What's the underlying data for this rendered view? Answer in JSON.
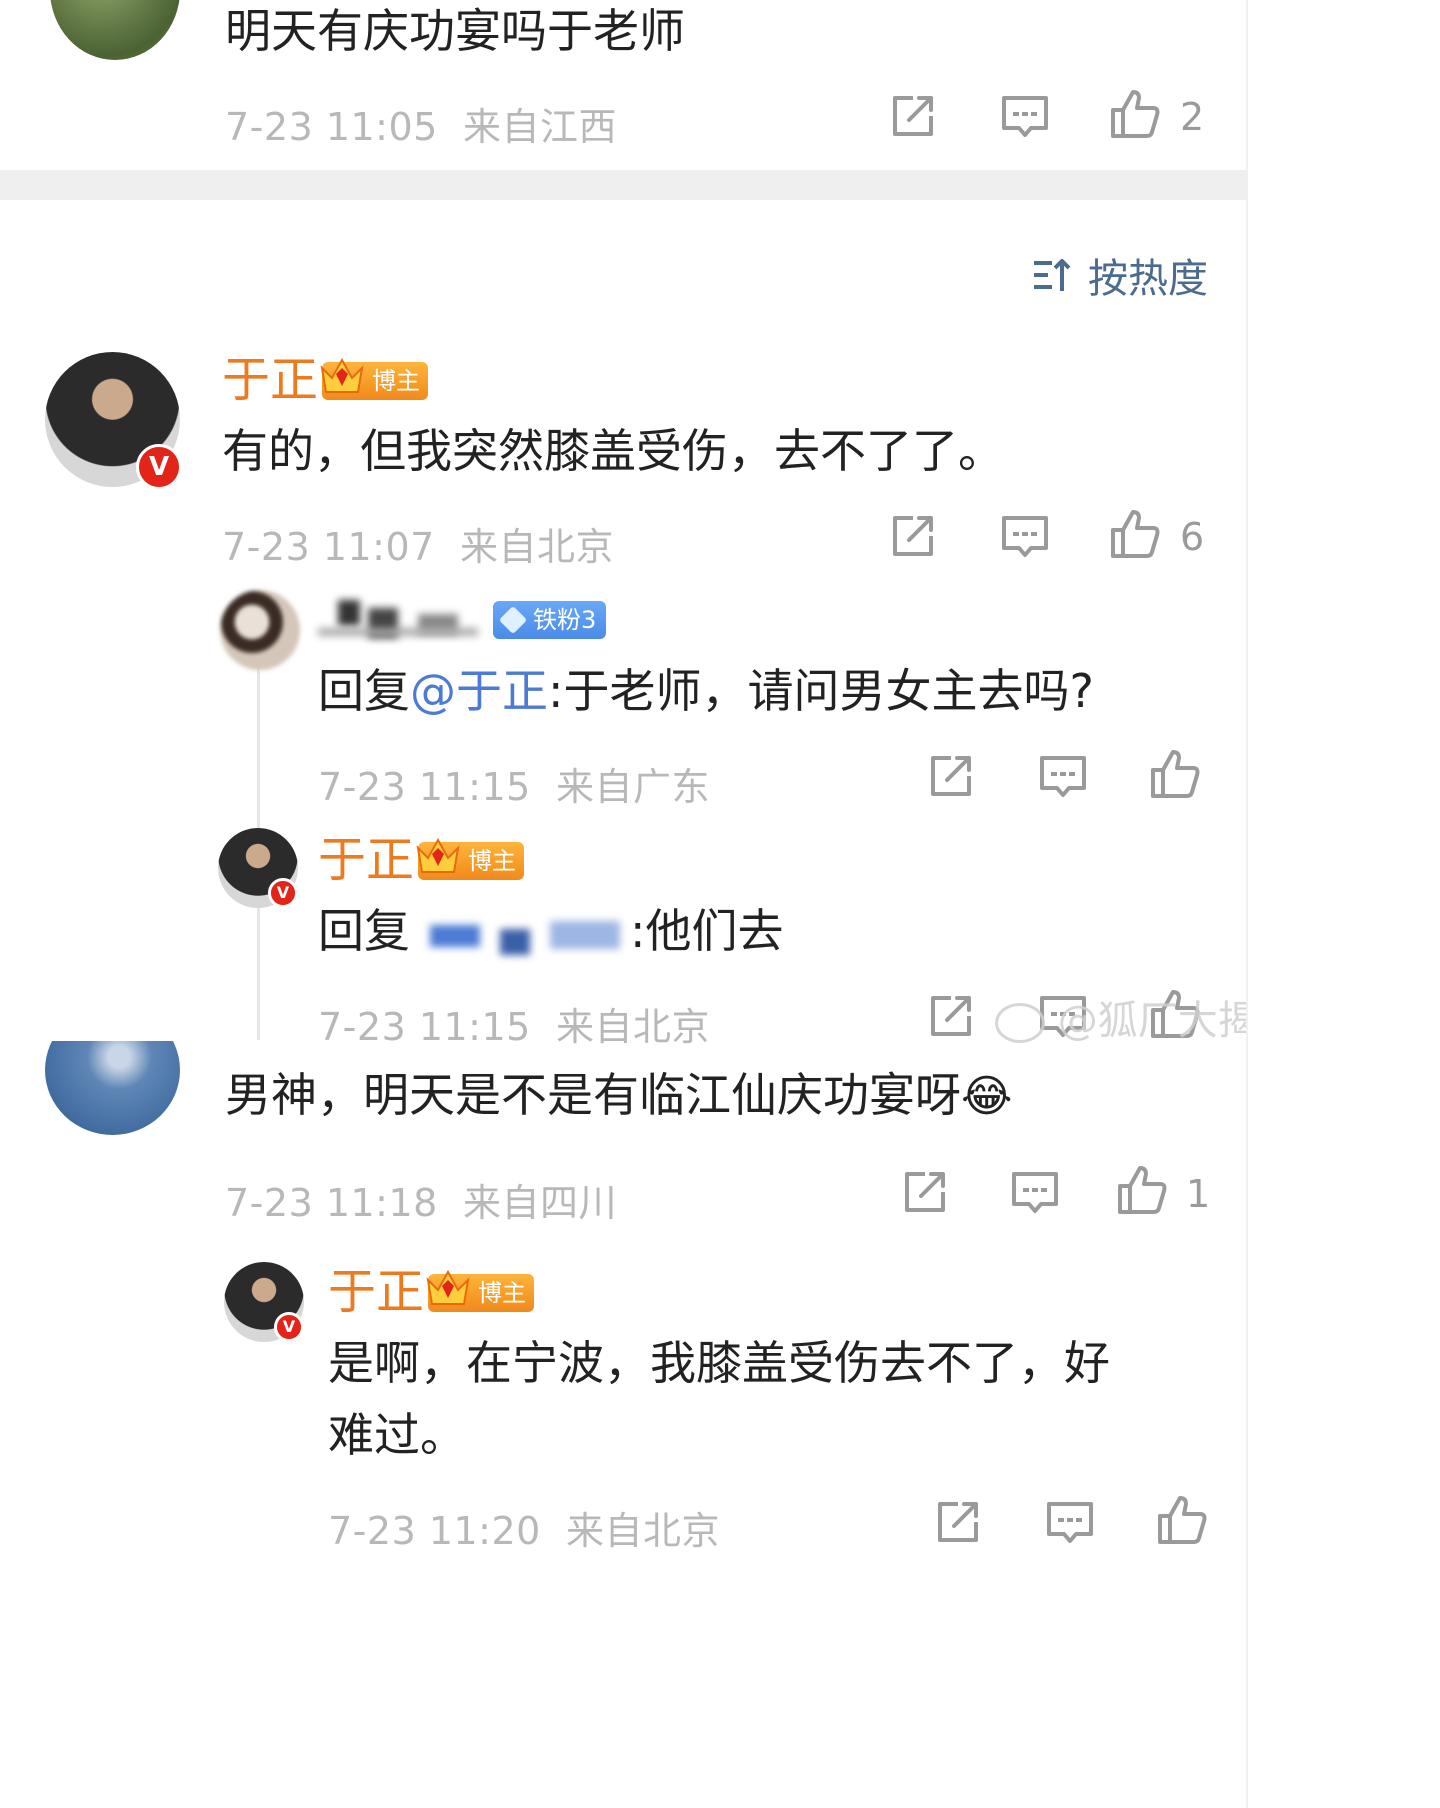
{
  "top_comment": {
    "text": "明天有庆功宴吗于老师",
    "time": "7-23 11:05",
    "location": "来自江西",
    "likes": "2"
  },
  "sort": {
    "label": "按热度",
    "icon": "sort-icon"
  },
  "comment1": {
    "name": "于正",
    "badge": "博主",
    "text": "有的，但我突然膝盖受伤，去不了了。",
    "time": "7-23 11:07",
    "location": "来自北京",
    "likes": "6",
    "verified": "V"
  },
  "reply1": {
    "fan_badge": "铁粉3",
    "prefix": "回复",
    "mention": "@于正",
    "text": ":于老师，请问男女主去吗?",
    "time": "7-23 11:15",
    "location": "来自广东"
  },
  "reply2": {
    "name": "于正",
    "badge": "博主",
    "prefix": "回复",
    "text": ":他们去",
    "time": "7-23 11:15",
    "location": "来自北京"
  },
  "comment2": {
    "text": "男神，明天是不是有临江仙庆功宴呀",
    "emoji": "😂",
    "time": "7-23 11:18",
    "location": "来自四川",
    "likes": "1"
  },
  "reply3": {
    "name": "于正",
    "badge": "博主",
    "text_line1": "是啊，在宁波，我膝盖受伤去不了，好",
    "text_line2": "难过。",
    "time": "7-23 11:20",
    "location": "来自北京"
  },
  "watermark": {
    "text": "@狐厂大揭问"
  },
  "colors": {
    "accent_orange": "#ee7a20",
    "mention_blue": "#4b7bd4",
    "meta_gray": "#b8b8b8",
    "fan_blue": "#4a8be8"
  }
}
